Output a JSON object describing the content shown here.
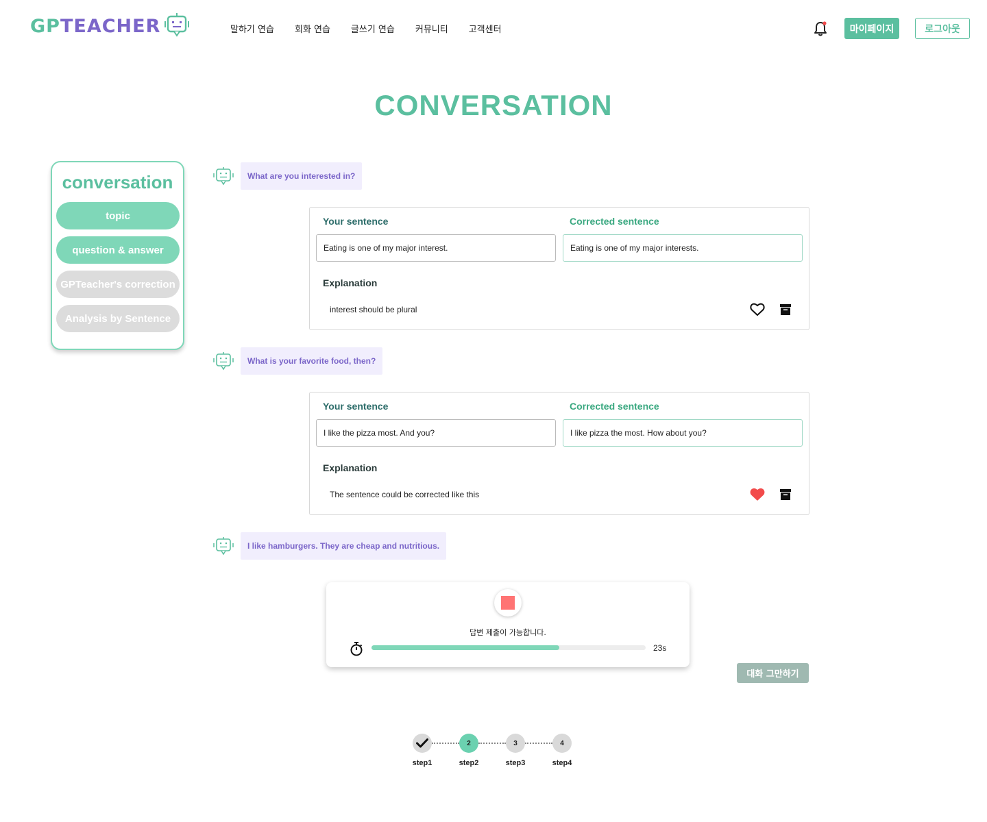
{
  "header": {
    "logo": {
      "part1": "GP",
      "part2": "TEACHER"
    },
    "nav": [
      "말하기 연습",
      "회화 연습",
      "글쓰기 연습",
      "커뮤니티",
      "고객센터"
    ],
    "mypage_label": "마이페이지",
    "logout_label": "로그아웃",
    "bell_icon": "bell-icon"
  },
  "page": {
    "title": "CONVERSATION"
  },
  "sidebar": {
    "title": "conversation",
    "items": [
      {
        "label": "topic",
        "active": true
      },
      {
        "label": "question & answer",
        "active": true
      },
      {
        "label": "GPTeacher's correction",
        "active": false
      },
      {
        "label": "Analysis by Sentence",
        "active": false
      }
    ]
  },
  "chat": {
    "messages": [
      {
        "bot": "What are you interested in?"
      },
      {
        "bot": "What is your favorite food, then?"
      },
      {
        "bot": "I like hamburgers. They are cheap and nutritious."
      }
    ],
    "corrections": [
      {
        "your_label": "Your sentence",
        "corrected_label": "Corrected sentence",
        "your": "Eating is one of my major interest.",
        "corrected": "Eating is one of my major interests.",
        "explanation_label": "Explanation",
        "explanation": "interest should be plural",
        "liked": false
      },
      {
        "your_label": "Your sentence",
        "corrected_label": "Corrected sentence",
        "your": "I like the pizza most. And you?",
        "corrected": "I like pizza the most. How about you?",
        "explanation_label": "Explanation",
        "explanation": "The sentence could be corrected like this",
        "liked": true
      }
    ]
  },
  "recorder": {
    "status": "답변 제출이 가능합니다.",
    "time_left": "23s",
    "progress": 0.685,
    "stop_color": "#ff7474"
  },
  "end_button_label": "대화 그만하기",
  "stepper": {
    "steps": [
      {
        "label": "step1",
        "num": "",
        "state": "done"
      },
      {
        "label": "step2",
        "num": "2",
        "state": "current"
      },
      {
        "label": "step3",
        "num": "3",
        "state": "todo"
      },
      {
        "label": "step4",
        "num": "4",
        "state": "todo"
      }
    ]
  },
  "colors": {
    "accent": "#5bbf9f",
    "accent_light": "#7fd7b8",
    "purple": "#7b66c9",
    "heart_red": "#f24b4b"
  }
}
